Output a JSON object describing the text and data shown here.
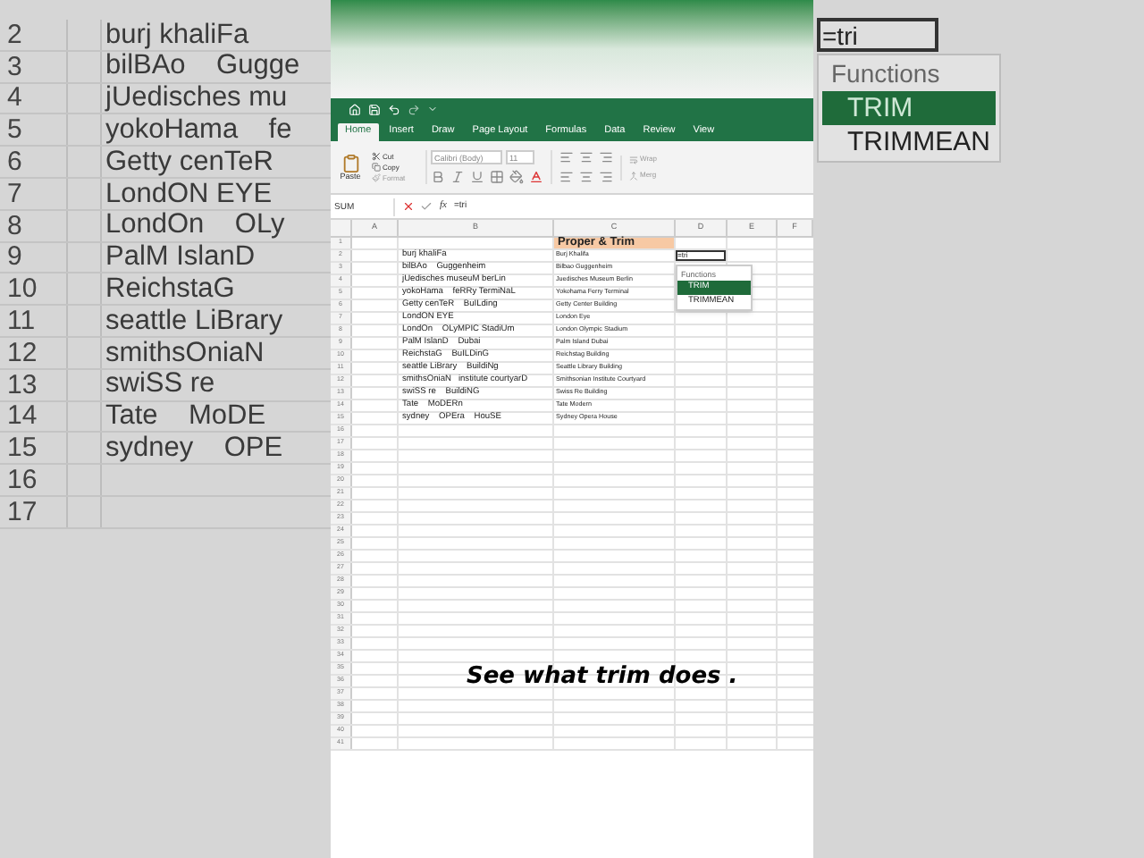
{
  "backdrop_left": {
    "rows": [
      {
        "number": "2",
        "text": "burj khaliFa"
      },
      {
        "number": "3",
        "text": "bilBAo    Gugge"
      },
      {
        "number": "4",
        "text": "jUedisches mu"
      },
      {
        "number": "5",
        "text": "yokoHama    fe"
      },
      {
        "number": "6",
        "text": "Getty cenTeR"
      },
      {
        "number": "7",
        "text": "LondON EYE"
      },
      {
        "number": "8",
        "text": "LondOn    OLy"
      },
      {
        "number": "9",
        "text": "PalM IslanD"
      },
      {
        "number": "10",
        "text": "ReichstaG"
      },
      {
        "number": "11",
        "text": "seattle LiBrary"
      },
      {
        "number": "12",
        "text": "smithsOniaN"
      },
      {
        "number": "13",
        "text": "swiSS re"
      },
      {
        "number": "14",
        "text": "Tate    MoDE"
      },
      {
        "number": "15",
        "text": "sydney    OPE"
      },
      {
        "number": "16"
      },
      {
        "number": "17"
      }
    ]
  },
  "backdrop_right": {
    "cell": "=tri",
    "suggestions": {
      "title": "Functions",
      "items": [
        {
          "label": "TRIM",
          "selected": true
        },
        {
          "label": "TRIMMEAN",
          "selected": false
        }
      ]
    }
  },
  "ribbon": {
    "tabs": [
      {
        "label": "Home",
        "selected": true
      },
      {
        "label": "Insert",
        "selected": false
      },
      {
        "label": "Draw",
        "selected": false
      },
      {
        "label": "Page Layout",
        "selected": false
      },
      {
        "label": "Formulas",
        "selected": false
      },
      {
        "label": "Data",
        "selected": false
      },
      {
        "label": "Review",
        "selected": false
      },
      {
        "label": "View",
        "selected": false
      }
    ],
    "paste": "Paste",
    "cut": "Cut",
    "copy": "Copy",
    "format": "Format",
    "font": "Calibri (Body)",
    "size": "11",
    "wrap": "Wrap",
    "merge": "Merg"
  },
  "formula_bar": {
    "name_box": "SUM",
    "function_label": "fx",
    "formula": "=tri"
  },
  "sheet": {
    "columns": [
      "A",
      "B",
      "C",
      "D",
      "E",
      "F"
    ],
    "header": "Proper & Trim",
    "edit_cell": "=tri",
    "suggestions": {
      "title": "Functions",
      "items": [
        {
          "label": "TRIM",
          "selected": true
        },
        {
          "label": "TRIMMEAN",
          "selected": false
        }
      ]
    },
    "rows": [
      {
        "number": "1"
      },
      {
        "number": "2",
        "b": "burj khaliFa",
        "c": "Burj Khalifa"
      },
      {
        "number": "3",
        "b": "bilBAo    Guggenheim",
        "c": "Bilbao Guggenheim"
      },
      {
        "number": "4",
        "b": "jUedisches museuM berLin",
        "c": "Juedisches Museum Berlin"
      },
      {
        "number": "5",
        "b": "yokoHama    feRRy TermiNaL",
        "c": "Yokohama Ferry Terminal"
      },
      {
        "number": "6",
        "b": "Getty cenTeR    BuILding",
        "c": "Getty Center Building"
      },
      {
        "number": "7",
        "b": "LondON EYE",
        "c": "London Eye"
      },
      {
        "number": "8",
        "b": "LondOn    OLyMPIC StadiUm",
        "c": "London Olympic Stadium"
      },
      {
        "number": "9",
        "b": "PalM IslanD    Dubai",
        "c": "Palm Island Dubai"
      },
      {
        "number": "10",
        "b": "ReichstaG    BuILDinG",
        "c": "Reichstag Building"
      },
      {
        "number": "11",
        "b": "seattle LiBrary    BuildiNg",
        "c": "Seattle Library Building"
      },
      {
        "number": "12",
        "b": "smithsOniaN   institute courtyarD",
        "c": "Smithsonian Institute Courtyard"
      },
      {
        "number": "13",
        "b": "swiSS re    BuildiNG",
        "c": "Swiss Re Building"
      },
      {
        "number": "14",
        "b": "Tate    MoDERn",
        "c": "Tate Modern"
      },
      {
        "number": "15",
        "b": "sydney    OPEra    HouSE",
        "c": "Sydney Opera House"
      },
      {
        "number": "16"
      },
      {
        "number": "17"
      },
      {
        "number": "18"
      },
      {
        "number": "19"
      },
      {
        "number": "20"
      },
      {
        "number": "21"
      },
      {
        "number": "22"
      },
      {
        "number": "23"
      },
      {
        "number": "24"
      },
      {
        "number": "25"
      },
      {
        "number": "26"
      },
      {
        "number": "27"
      },
      {
        "number": "28"
      },
      {
        "number": "29"
      },
      {
        "number": "30"
      },
      {
        "number": "31"
      },
      {
        "number": "32"
      },
      {
        "number": "33"
      },
      {
        "number": "34"
      },
      {
        "number": "35"
      },
      {
        "number": "36"
      },
      {
        "number": "37"
      },
      {
        "number": "38"
      },
      {
        "number": "39"
      },
      {
        "number": "40"
      },
      {
        "number": "41"
      }
    ]
  },
  "caption": "See what trim does ."
}
